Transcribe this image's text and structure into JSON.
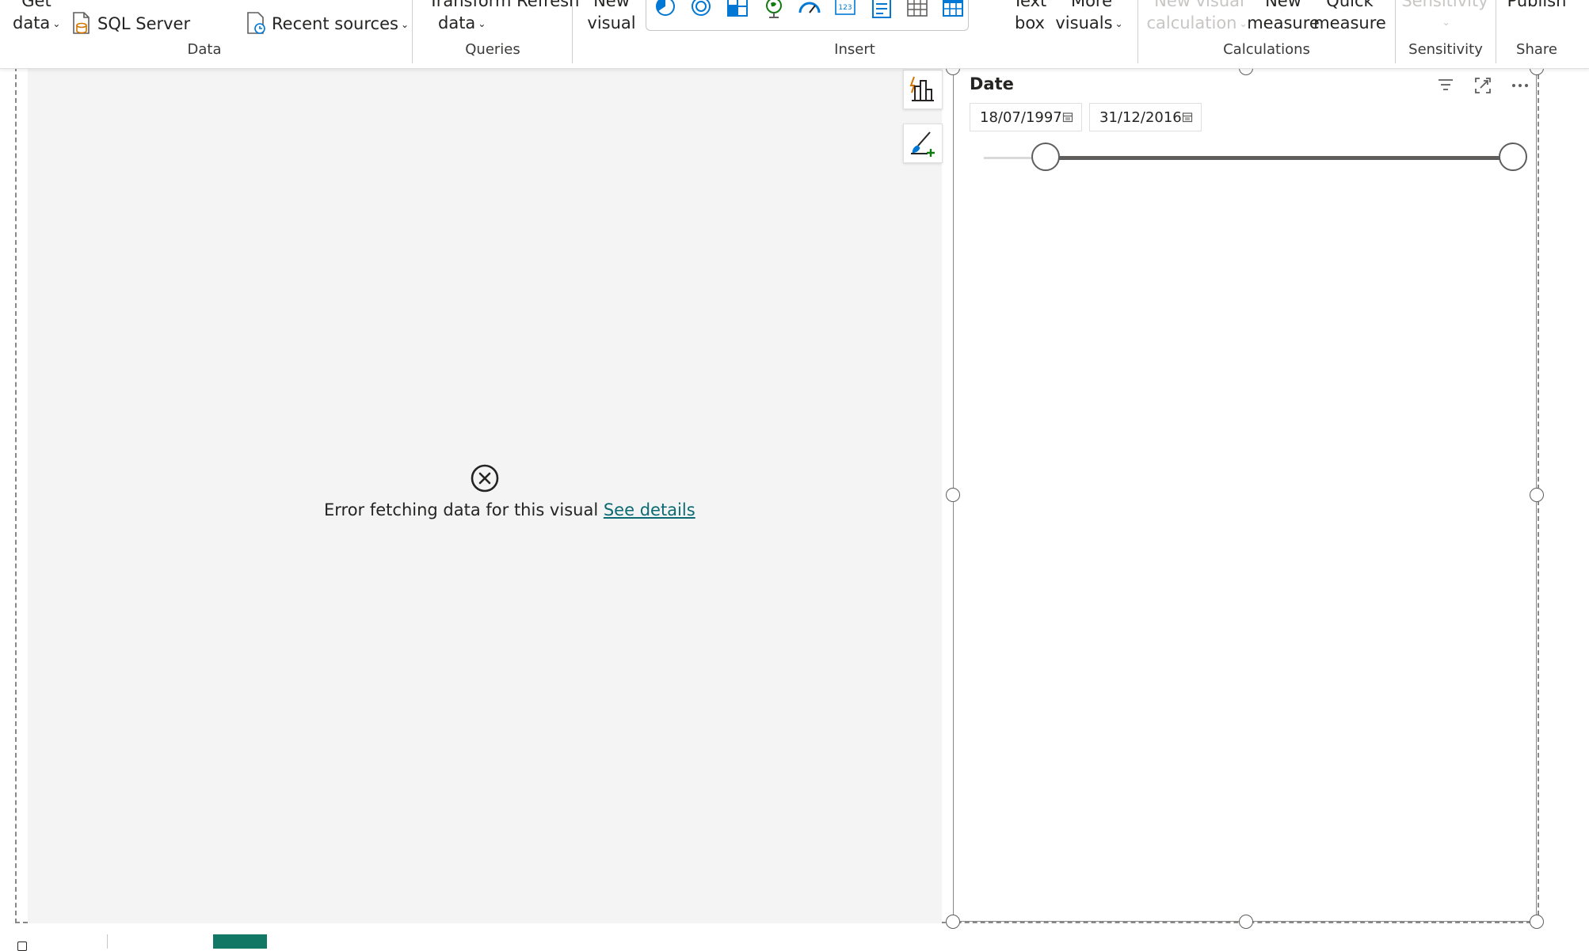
{
  "ribbon": {
    "data_group": {
      "label": "Data",
      "get_data_line1": "Get",
      "get_data_line2": "data",
      "sql_server": "SQL Server",
      "recent_sources": "Recent sources"
    },
    "queries_group": {
      "label": "Queries",
      "transform_refresh": "Transform Refresh",
      "data": "data"
    },
    "insert_group": {
      "label": "Insert",
      "new_visual_line1": "New",
      "new_visual_line2": "visual",
      "text_box_line1": "Text",
      "text_box_line2": "box",
      "more_visuals_line1": "More",
      "more_visuals_line2": "visuals"
    },
    "calculations_group": {
      "label": "Calculations",
      "new_visual_calc_line1": "New visual",
      "new_visual_calc_line2": "calculation",
      "new_measure_line1": "New",
      "new_measure_line2": "measure",
      "quick_measure_line1": "Quick",
      "quick_measure_line2": "measure"
    },
    "sensitivity_group": {
      "label": "Sensitivity",
      "button": "Sensitivity"
    },
    "share_group": {
      "label": "Share",
      "publish": "Publish"
    }
  },
  "visual_left": {
    "error_text": "Error fetching data for this visual",
    "link_text": "See details"
  },
  "slicer": {
    "title": "Date",
    "start_date": "18/07/1997",
    "end_date": "31/12/2016",
    "range_start_fraction": 0.12,
    "range_end_fraction": 1.0
  },
  "colors": {
    "accent": "#117865",
    "link": "#0b6a73",
    "canvas_bg": "#f4f4f4",
    "track": "#605e5c"
  }
}
